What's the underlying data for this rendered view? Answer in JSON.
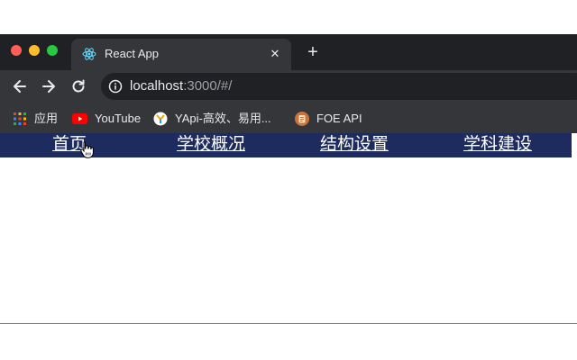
{
  "browser": {
    "colors": {
      "tab_strip": "#202124",
      "toolbar": "#35363a",
      "close_dot": "#ff5f57",
      "minimize_dot": "#febc2e",
      "maximize_dot": "#28c840"
    },
    "tab": {
      "title": "React App",
      "icon": "react-icon"
    },
    "toolbar": {
      "url_host": "localhost",
      "url_rest": ":3000/#/"
    },
    "bookmarks": [
      {
        "label": "应用",
        "icon": "apps-grid-icon"
      },
      {
        "label": "YouTube",
        "icon": "youtube-icon"
      },
      {
        "label": "YApi-高效、易用...",
        "icon": "yapi-icon"
      },
      {
        "label": "FOE API",
        "icon": "foe-api-icon"
      }
    ]
  },
  "page": {
    "colors": {
      "nav_background": "#1d2b5e",
      "nav_text": "#ffffff"
    },
    "nav": [
      {
        "label": "首页"
      },
      {
        "label": "学校概况"
      },
      {
        "label": "结构设置"
      },
      {
        "label": "学科建设"
      }
    ]
  }
}
